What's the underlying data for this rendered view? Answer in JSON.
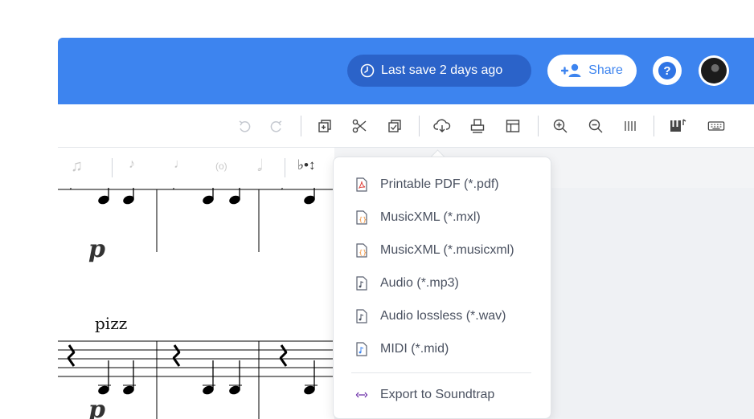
{
  "header": {
    "last_save": "Last save 2 days ago",
    "share_label": "Share",
    "help_label": "?"
  },
  "toolbar": {
    "icons": [
      "undo-icon",
      "redo-icon",
      "duplicate-icon",
      "cut-icon",
      "select-icon",
      "export-icon",
      "print-icon",
      "layout-icon",
      "zoom-in-icon",
      "zoom-out-icon",
      "measures-icon",
      "instruments-icon",
      "keyboard-icon"
    ]
  },
  "score": {
    "dynamic_1": "p",
    "dynamic_2": "p",
    "technique": "pizz"
  },
  "export_menu": {
    "items": [
      {
        "label": "Printable PDF (*.pdf)",
        "icon": "pdf-file-icon",
        "color": "#e0443e"
      },
      {
        "label": "MusicXML (*.mxl)",
        "icon": "musicxml-file-icon",
        "color": "#f08a2c"
      },
      {
        "label": "MusicXML (*.musicxml)",
        "icon": "musicxml-file-icon",
        "color": "#f08a2c"
      },
      {
        "label": "Audio (*.mp3)",
        "icon": "audio-file-icon",
        "color": "#4a5160"
      },
      {
        "label": "Audio lossless (*.wav)",
        "icon": "audio-file-icon",
        "color": "#4a5160"
      },
      {
        "label": "MIDI (*.mid)",
        "icon": "midi-file-icon",
        "color": "#3d84ef"
      }
    ],
    "soundtrap_label": "Export to Soundtrap"
  },
  "colors": {
    "topbar": "#3d84ef",
    "save_pill": "#2b63c9",
    "accent": "#3d84ef",
    "soundtrap_icon": "#6b2ea8"
  }
}
